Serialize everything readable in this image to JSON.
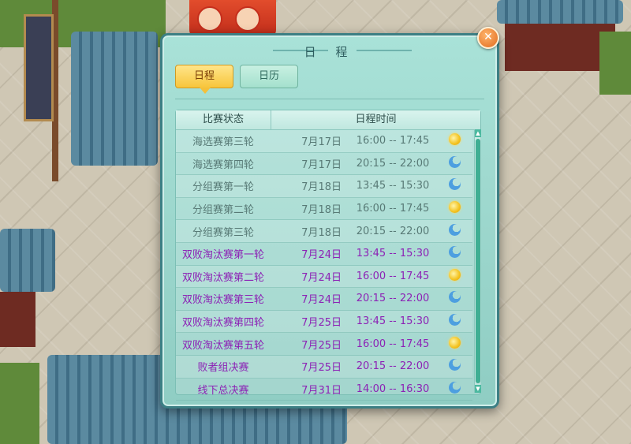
{
  "panel": {
    "title": "日 程",
    "close_label": "✕",
    "tabs": [
      {
        "label": "日程",
        "active": true
      },
      {
        "label": "日历",
        "active": false
      }
    ]
  },
  "table": {
    "headers": {
      "status": "比赛状态",
      "time": "日程时间"
    },
    "rows": [
      {
        "status": "海选赛第三轮",
        "date": "7月17日",
        "time": "16:00 -- 17:45",
        "icon": "sun-icon",
        "state": "past"
      },
      {
        "status": "海选赛第四轮",
        "date": "7月17日",
        "time": "20:15 -- 22:00",
        "icon": "moon-icon",
        "state": "past"
      },
      {
        "status": "分组赛第一轮",
        "date": "7月18日",
        "time": "13:45 -- 15:30",
        "icon": "moon-icon",
        "state": "past"
      },
      {
        "status": "分组赛第二轮",
        "date": "7月18日",
        "time": "16:00 -- 17:45",
        "icon": "sun-icon",
        "state": "past"
      },
      {
        "status": "分组赛第三轮",
        "date": "7月18日",
        "time": "20:15 -- 22:00",
        "icon": "moon-icon",
        "state": "past"
      },
      {
        "status": "双败淘汰赛第一轮",
        "date": "7月24日",
        "time": "13:45 -- 15:30",
        "icon": "moon-icon",
        "state": "future"
      },
      {
        "status": "双败淘汰赛第二轮",
        "date": "7月24日",
        "time": "16:00 -- 17:45",
        "icon": "sun-icon",
        "state": "future"
      },
      {
        "status": "双败淘汰赛第三轮",
        "date": "7月24日",
        "time": "20:15 -- 22:00",
        "icon": "moon-icon",
        "state": "future"
      },
      {
        "status": "双败淘汰赛第四轮",
        "date": "7月25日",
        "time": "13:45 -- 15:30",
        "icon": "moon-icon",
        "state": "future"
      },
      {
        "status": "双败淘汰赛第五轮",
        "date": "7月25日",
        "time": "16:00 -- 17:45",
        "icon": "sun-icon",
        "state": "future"
      },
      {
        "status": "败者组决赛",
        "date": "7月25日",
        "time": "20:15 -- 22:00",
        "icon": "moon-icon",
        "state": "future"
      },
      {
        "status": "线下总决赛",
        "date": "7月31日",
        "time": "14:00 -- 16:30",
        "icon": "moon-icon",
        "state": "future"
      }
    ]
  },
  "colors": {
    "past_text": "#587a76",
    "future_text": "#8c22b5",
    "active_tab": "#f7c53b"
  }
}
